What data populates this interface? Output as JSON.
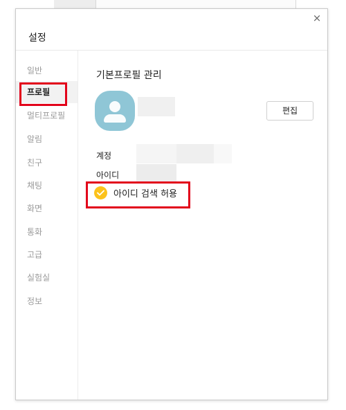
{
  "dialog": {
    "title": "설정",
    "close_icon_glyph": "×"
  },
  "sidebar": {
    "items": [
      {
        "label": "일반",
        "active": false
      },
      {
        "label": "프로필",
        "active": true
      },
      {
        "label": "멀티프로필",
        "active": false
      },
      {
        "label": "알림",
        "active": false
      },
      {
        "label": "친구",
        "active": false
      },
      {
        "label": "채팅",
        "active": false
      },
      {
        "label": "화면",
        "active": false
      },
      {
        "label": "통화",
        "active": false
      },
      {
        "label": "고급",
        "active": false
      },
      {
        "label": "실험실",
        "active": false
      },
      {
        "label": "정보",
        "active": false
      }
    ]
  },
  "profile": {
    "section_title": "기본프로필 관리",
    "edit_label": "편집",
    "avatar_icon": "default-person-icon",
    "avatar_color": "#8fc6d6"
  },
  "account": {
    "account_label": "계정",
    "id_label": "아이디",
    "id_search_label": "아이디 검색 허용",
    "id_search_checked": true,
    "check_color": "#fcc21b"
  },
  "highlight_color": "#e2001a"
}
